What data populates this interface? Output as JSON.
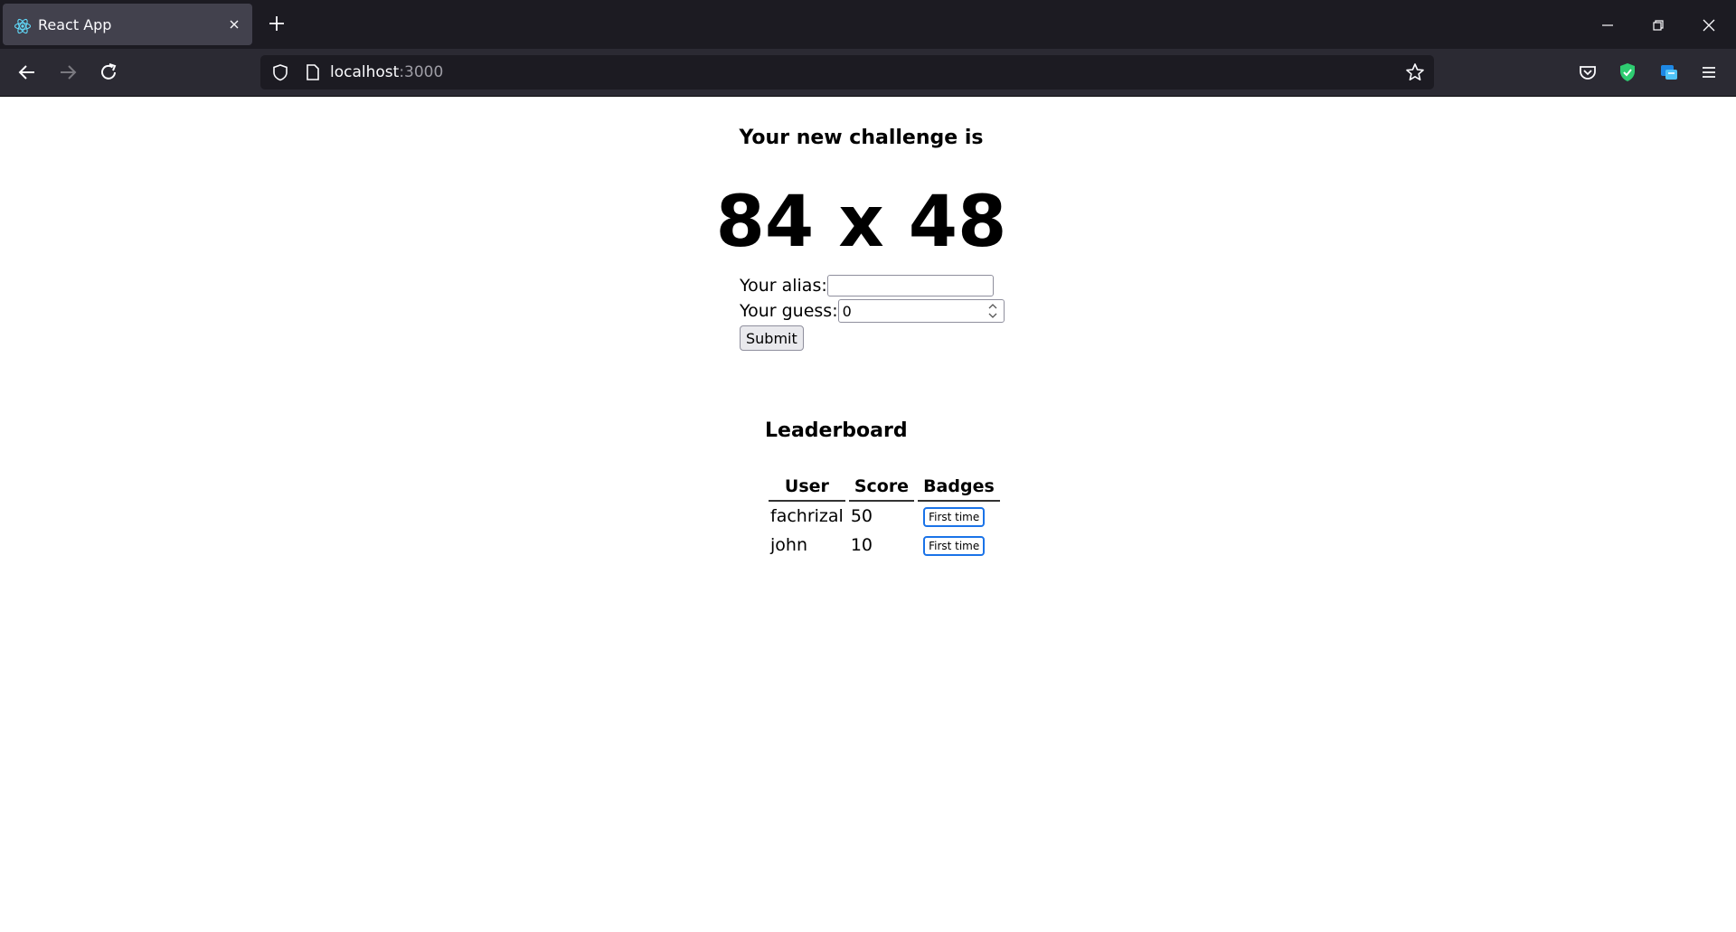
{
  "browser": {
    "tab_title": "React App",
    "url_host": "localhost",
    "url_port": ":3000",
    "icons": {
      "favicon": "react-icon",
      "tab_close": "close-icon",
      "new_tab": "plus-icon",
      "back": "arrow-left-icon",
      "forward": "arrow-right-icon",
      "reload": "reload-icon",
      "tracking": "shield-icon",
      "page": "page-icon",
      "bookmark": "star-icon",
      "pocket": "pocket-icon",
      "adblock": "shield-check-icon",
      "extension": "translate-icon",
      "menu": "hamburger-icon",
      "minimize": "minimize-icon",
      "restore": "restore-icon",
      "close_window": "close-icon"
    }
  },
  "challenge": {
    "title": "Your new challenge is",
    "factors": "84 x 48"
  },
  "form": {
    "alias_label": "Your alias:",
    "alias_value": "",
    "guess_label": "Your guess:",
    "guess_value": "0",
    "submit_label": "Submit"
  },
  "leaderboard": {
    "title": "Leaderboard",
    "headers": [
      "User",
      "Score",
      "Badges"
    ],
    "rows": [
      {
        "user": "fachrizal",
        "score": "50",
        "badge": "First time"
      },
      {
        "user": "john",
        "score": "10",
        "badge": "First time"
      }
    ]
  },
  "colors": {
    "chrome_dark": "#1c1b22",
    "toolbar": "#2b2a33",
    "tab_active": "#42414d",
    "badge_border": "#1a73e8",
    "adblock_green": "#2ecc71"
  }
}
